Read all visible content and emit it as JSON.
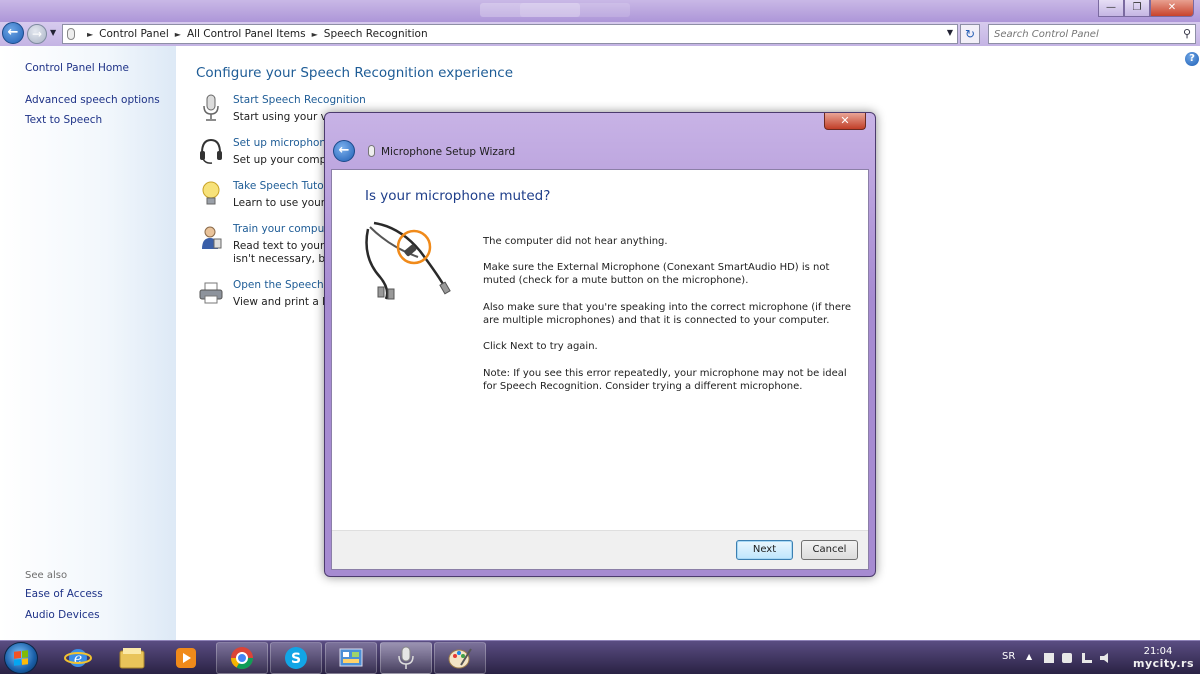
{
  "window": {
    "address_crumbs": [
      "Control Panel",
      "All Control Panel Items",
      "Speech Recognition"
    ],
    "search_placeholder": "Search Control Panel"
  },
  "sidebar": {
    "home": "Control Panel Home",
    "links": [
      "Advanced speech options",
      "Text to Speech"
    ],
    "see_also_label": "See also",
    "see_also_links": [
      "Ease of Access",
      "Audio Devices"
    ]
  },
  "main": {
    "title": "Configure your Speech Recognition experience",
    "tasks": [
      {
        "icon": "microphone-icon",
        "link": "Start Speech Recognition",
        "desc": "Start using your voi",
        "desc2": ""
      },
      {
        "icon": "headset-icon",
        "link": "Set up microphone",
        "desc": "Set up your comput",
        "desc2": ""
      },
      {
        "icon": "lightbulb-icon",
        "link": "Take Speech Tutori",
        "desc": "Learn to use your co",
        "desc2": ""
      },
      {
        "icon": "user-train-icon",
        "link": "Train your compute",
        "desc": "Read text to your co",
        "desc2": "isn't necessary, but"
      },
      {
        "icon": "printer-icon",
        "link": "Open the Speech Re",
        "desc": "View and print a list",
        "desc2": ""
      }
    ]
  },
  "dialog": {
    "title": "Microphone Setup Wizard",
    "heading": "Is your microphone muted?",
    "messages": [
      "The computer did not hear anything.",
      "Make sure the External Microphone (Conexant SmartAudio HD) is not muted (check for a mute button on the microphone).",
      " Also make sure that you're speaking into the correct microphone (if there are multiple microphones) and that it is connected to your computer.",
      "Click Next to try again.",
      "Note: If you see this error repeatedly, your microphone may not be ideal for Speech Recognition. Consider trying a different microphone."
    ],
    "next_label": "Next",
    "cancel_label": "Cancel"
  },
  "taskbar": {
    "apps": [
      "internet-explorer-icon",
      "folder-icon",
      "media-player-icon",
      "chrome-icon",
      "skype-icon",
      "control-panel-icon",
      "speech-mic-icon",
      "paint-icon"
    ],
    "language": "SR",
    "time": "21:04",
    "watermark": "mycity.rs"
  },
  "colors": {
    "link": "#1e5c96",
    "title_text": "#1e5c96",
    "dialog_frame": "#a68bd1",
    "taskbar": "#2a2244"
  }
}
